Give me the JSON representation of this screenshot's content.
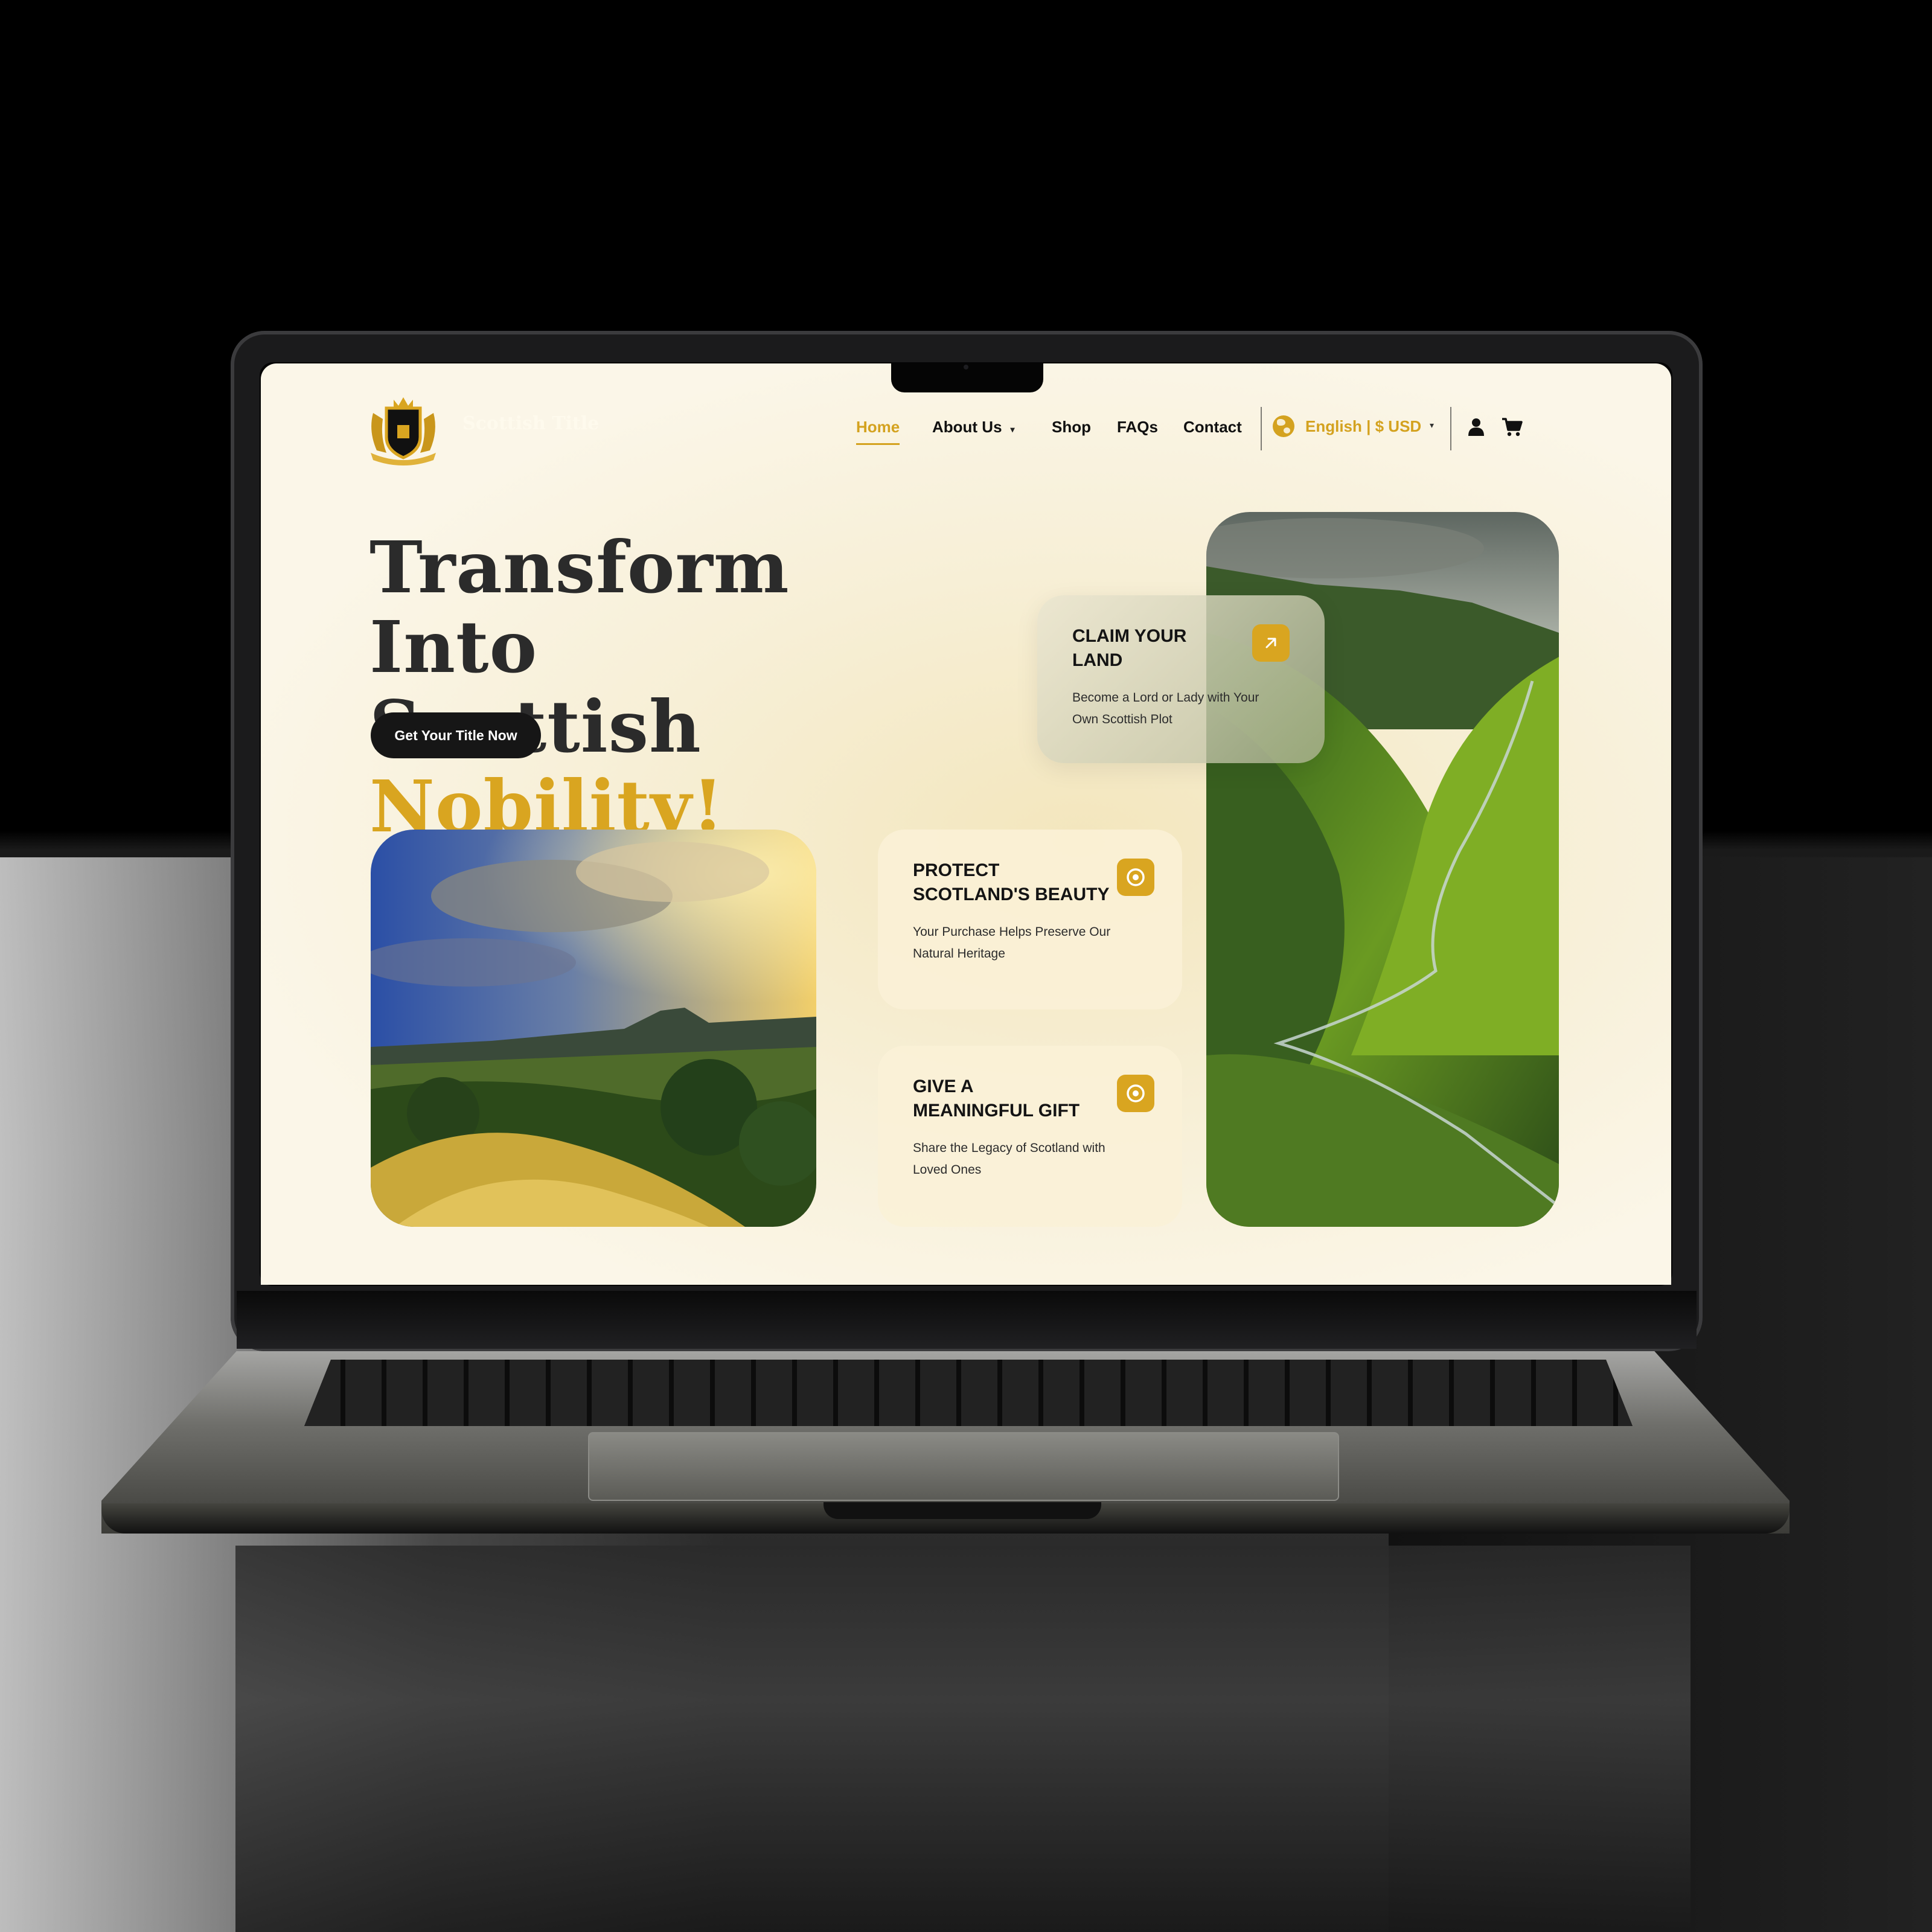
{
  "colors": {
    "accent": "#d9a520",
    "text": "#141414",
    "page_background": "#fbf6e8",
    "button_background": "#161616",
    "button_text": "#ffffff"
  },
  "nav": {
    "logo_icon": "coat-of-arms-logo",
    "brand_text": "Scottish Title",
    "links": [
      "Home",
      "About Us",
      "Shop",
      "FAQs",
      "Contact"
    ],
    "active_link": "Home",
    "about_us_has_dropdown": true,
    "language_currency": "English | $ USD",
    "language_icon": "globe-icon",
    "account_icon": "user-icon",
    "cart_icon": "cart-icon"
  },
  "hero": {
    "headline_line1": "Transform Into",
    "headline_line2_prefix": "Scottish",
    "headline_highlight": "Nobility!",
    "cta_label": "Get Your Title Now"
  },
  "cards": [
    {
      "title_line1": "CLAIM YOUR",
      "title_line2": "LAND",
      "description_line1": "Become a Lord or Lady with Your",
      "description_line2": "Own Scottish Plot",
      "icon": "arrow-up-right-icon"
    },
    {
      "title_line1": "PROTECT",
      "title_line2": "SCOTLAND'S BEAUTY",
      "description_line1": "Your Purchase Helps Preserve Our",
      "description_line2": "Natural Heritage",
      "icon": "target-icon"
    },
    {
      "title_line1": "GIVE A",
      "title_line2": "MEANINGFUL GIFT",
      "description_line1": "Share the Legacy of Scotland with",
      "description_line2": "Loved Ones",
      "icon": "target-icon"
    }
  ],
  "images": {
    "left": "scottish-hills-sunset-photo",
    "right": "highland-valley-river-photo"
  }
}
